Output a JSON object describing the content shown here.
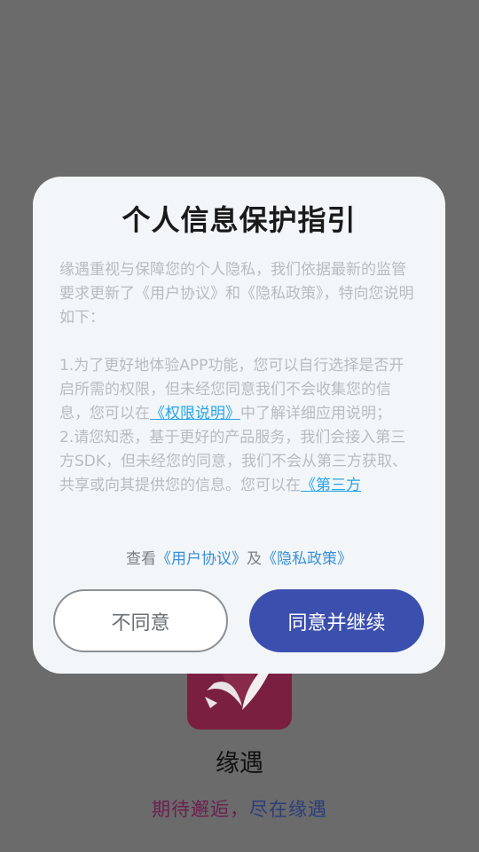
{
  "app": {
    "name": "缘遇",
    "slogan_part1": "期待邂逅，",
    "slogan_part2": "尽在缘遇"
  },
  "dialog": {
    "title": "个人信息保护指引",
    "intro": "缘遇重视与保障您的个人隐私，我们依据最新的监管要求更新了《用户协议》和《隐私政策》，特向您说明如下：",
    "item1_before": "1.为了更好地体验APP功能，您可以自行选择是否开启所需的权限，但未经您同意我们不会收集您的信息，您可以在",
    "item1_link": "《权限说明》",
    "item1_after": "中了解详细应用说明；",
    "item2_before": "2.请您知悉，基于更好的产品服务，我们会接入第三方SDK，但未经您的同意，我们不会从第三方获取、共享或向其提供您的信息。您可以在",
    "item2_link": "《第三方",
    "view_prefix": "查看",
    "user_agreement_link": "《用户协议》",
    "and_text": "及",
    "privacy_policy_link": "《隐私政策》",
    "disagree_label": "不同意",
    "agree_label": "同意并继续"
  },
  "colors": {
    "overlay_bg": "#6b6b6b",
    "dialog_bg": "#f2f6f8",
    "agree_button": "#3b4fae",
    "link": "#27a4e8"
  }
}
